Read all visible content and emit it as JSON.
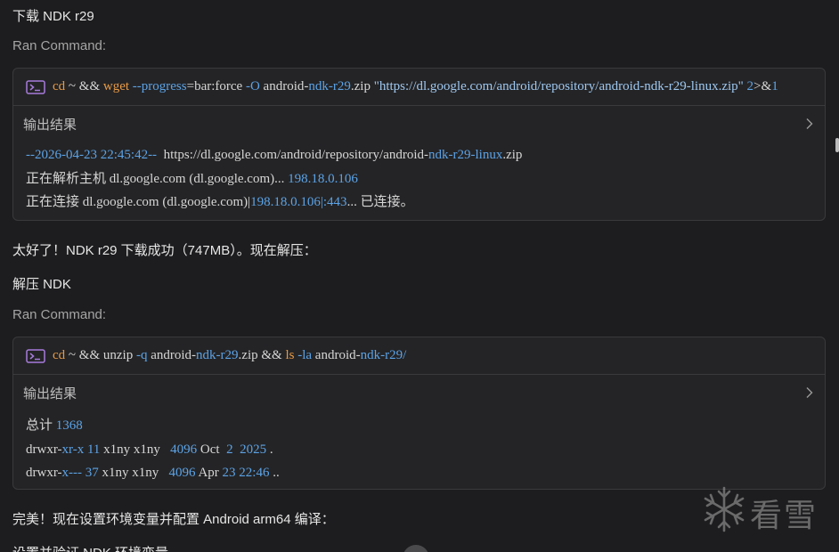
{
  "step1": {
    "title": "下载 NDK r29",
    "ran_label": "Ran Command:",
    "command": {
      "p1": "cd",
      "p2": " ~ && ",
      "p3": "wget",
      "p4": " ",
      "p5": "--progress",
      "p6": "=bar:force ",
      "p7": "-O",
      "p8": " android-",
      "p9": "ndk-r29",
      "p10": ".zip ",
      "p11": "\"https://dl.google.com/android/repository/android-ndk-r29-linux.zip\"",
      "p12": " ",
      "p13": "2",
      "p14": ">&",
      "p15": "1"
    },
    "output_label": "输出结果",
    "output": {
      "l1a": "--2026-04-23 22:45:42--",
      "l1b": "  https://dl.google.com/android/repository/android-",
      "l1c": "ndk-r29-linux",
      "l1d": ".zip",
      "l2a": "正在解析主机 dl.google.com (dl.google.com)... ",
      "l2b": "198.18.0.106",
      "l3a": "正在连接 dl.google.com (dl.google.com)|",
      "l3b": "198.18.0.106",
      "l3c": "|:443",
      "l3d": "... 已连接。"
    }
  },
  "message1": "太好了！NDK r29 下载成功（747MB）。现在解压：",
  "step2": {
    "title": "解压 NDK",
    "ran_label": "Ran Command:",
    "command": {
      "p1": "cd",
      "p2": " ~ && unzip ",
      "p3": "-q",
      "p4": " android-",
      "p5": "ndk-r29",
      "p6": ".zip && ",
      "p7": "ls",
      "p8": " ",
      "p9": "-la",
      "p10": " android-",
      "p11": "ndk-r29/"
    },
    "output_label": "输出结果",
    "output": {
      "l1a": "总计 ",
      "l1b": "1368",
      "l2a": "drwxr-",
      "l2b": "xr-x 11",
      "l2c": " x1ny x1ny   ",
      "l2d": "4096",
      "l2e": " Oct  ",
      "l2f": "2  2025",
      "l2g": " .",
      "l3a": "drwxr-",
      "l3b": "x--- 37",
      "l3c": " x1ny x1ny   ",
      "l3d": "4096",
      "l3e": " Apr ",
      "l3f": "23 22:46",
      "l3g": " .."
    }
  },
  "message2": "完美！现在设置环境变量并配置 Android arm64 编译：",
  "step3_title": "设置并验证 NDK 环境变量",
  "watermark_text": "看雪",
  "colors": {
    "background": "#1d1d1f",
    "card": "#242426",
    "keyword": "#e89a45",
    "flag": "#5ca3e6",
    "icon": "#a77bdc"
  }
}
